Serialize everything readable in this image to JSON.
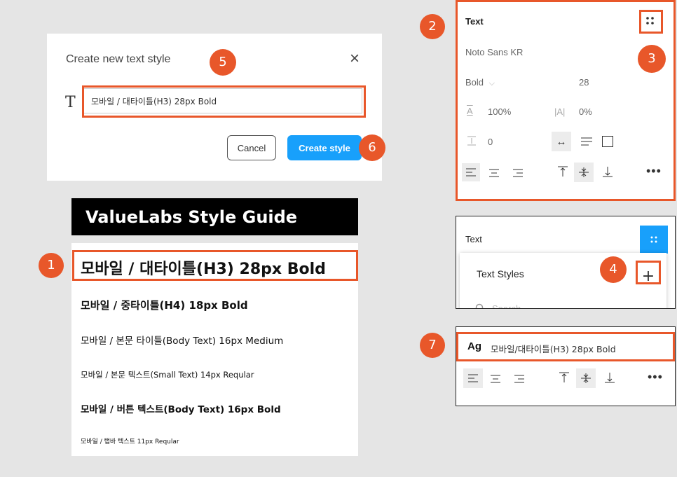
{
  "dialog": {
    "title": "Create new text style",
    "close_glyph": "×",
    "type_glyph": "T",
    "name_value": "모바일 / 대타이틀(H3) 28px Bold",
    "cancel_label": "Cancel",
    "create_label": "Create style"
  },
  "style_guide": {
    "header": "ValueLabs Style Guide",
    "items": [
      "모바일 / 대타이틀(H3) 28px Bold",
      "모바일 / 중타이틀(H4) 18px Bold",
      "모바일 / 본문 타이틀(Body Text) 16px Medium",
      "모바일 / 본문 텍스트(Small Text) 14px Reqular",
      "모바일 / 버튼 텍스트(Body Text) 16px Bold",
      "모바일 / 탭바 텍스트 11px Reqular"
    ]
  },
  "text_panel": {
    "title": "Text",
    "font_family": "Noto Sans KR",
    "weight": "Bold",
    "size": "28",
    "line_height_glyph": "A",
    "line_height": "100%",
    "letter_spacing_glyph": "|A|",
    "letter_spacing": "0%",
    "paragraph_spacing": "0"
  },
  "styles_panel": {
    "title": "Text",
    "dropdown_title": "Text Styles",
    "search_placeholder": "Search"
  },
  "applied_panel": {
    "ag": "Ag",
    "style_name": "모바일/대타이틀(H3) 28px Bold"
  },
  "badges": [
    "1",
    "2",
    "3",
    "4",
    "5",
    "6",
    "7"
  ],
  "colors": {
    "accent": "#e8572a",
    "blue": "#18a0fb"
  }
}
